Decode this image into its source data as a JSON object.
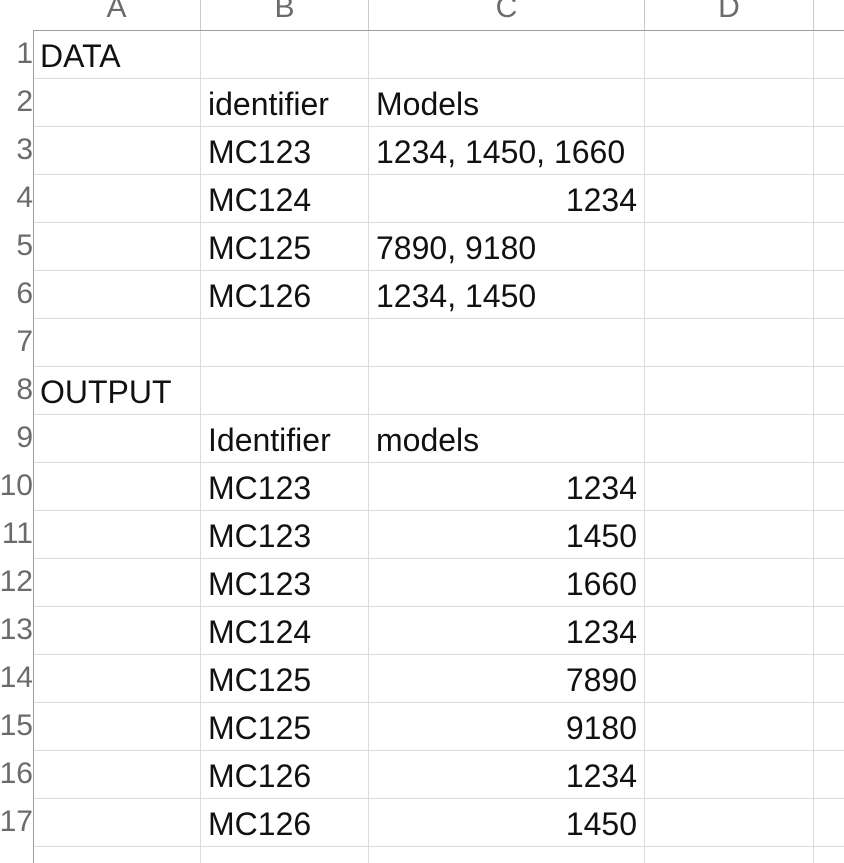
{
  "columns": [
    "A",
    "B",
    "C",
    "D"
  ],
  "row_numbers": [
    "1",
    "2",
    "3",
    "4",
    "5",
    "6",
    "7",
    "8",
    "9",
    "10",
    "11",
    "12",
    "13",
    "14",
    "15",
    "16",
    "17"
  ],
  "cells": {
    "A1": "DATA",
    "B2": "identifier",
    "C2": "Models",
    "B3": "MC123",
    "C3": "1234, 1450, 1660",
    "B4": "MC124",
    "C4": "1234",
    "B5": "MC125",
    "C5": "7890, 9180",
    "B6": "MC126",
    "C6": "1234, 1450",
    "A8": "OUTPUT",
    "B9": "Identifier",
    "C9": "models",
    "B10": "MC123",
    "C10": "1234",
    "B11": "MC123",
    "C11": "1450",
    "B12": "MC123",
    "C12": "1660",
    "B13": "MC124",
    "C13": "1234",
    "B14": "MC125",
    "C14": "7890",
    "B15": "MC125",
    "C15": "9180",
    "B16": "MC126",
    "C16": "1234",
    "B17": "MC126",
    "C17": "1450"
  }
}
